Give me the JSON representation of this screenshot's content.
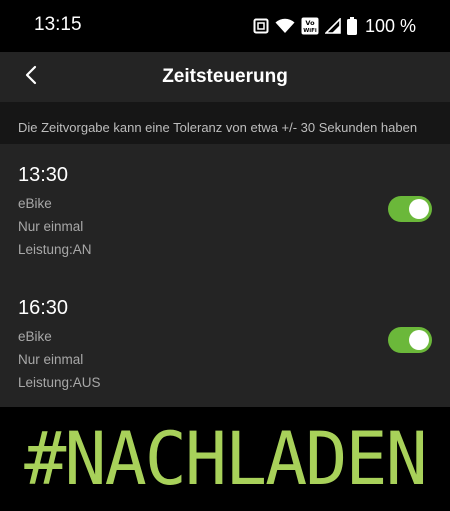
{
  "status_bar": {
    "time": "13:15",
    "icons": [
      "nfc-icon",
      "wifi-icon",
      "vowifi-icon",
      "signal-icon",
      "battery-icon"
    ],
    "vowifi_label": "Vo WiFi",
    "battery": "100 %"
  },
  "app_bar": {
    "back_icon": "chevron-left-icon",
    "title": "Zeitsteuerung"
  },
  "info": "Die Zeitvorgabe kann eine Toleranz von etwa +/- 30 Sekunden haben",
  "schedules": [
    {
      "time": "13:30",
      "device": "eBike",
      "repeat": "Nur einmal",
      "power": "Leistung:AN",
      "enabled": true
    },
    {
      "time": "16:30",
      "device": "eBike",
      "repeat": "Nur einmal",
      "power": "Leistung:AUS",
      "enabled": true
    }
  ],
  "banner": "#NACHLADEN",
  "colors": {
    "accent": "#6bb83a",
    "banner_text": "#a8d15a",
    "surface": "#242424",
    "background": "#000000"
  }
}
